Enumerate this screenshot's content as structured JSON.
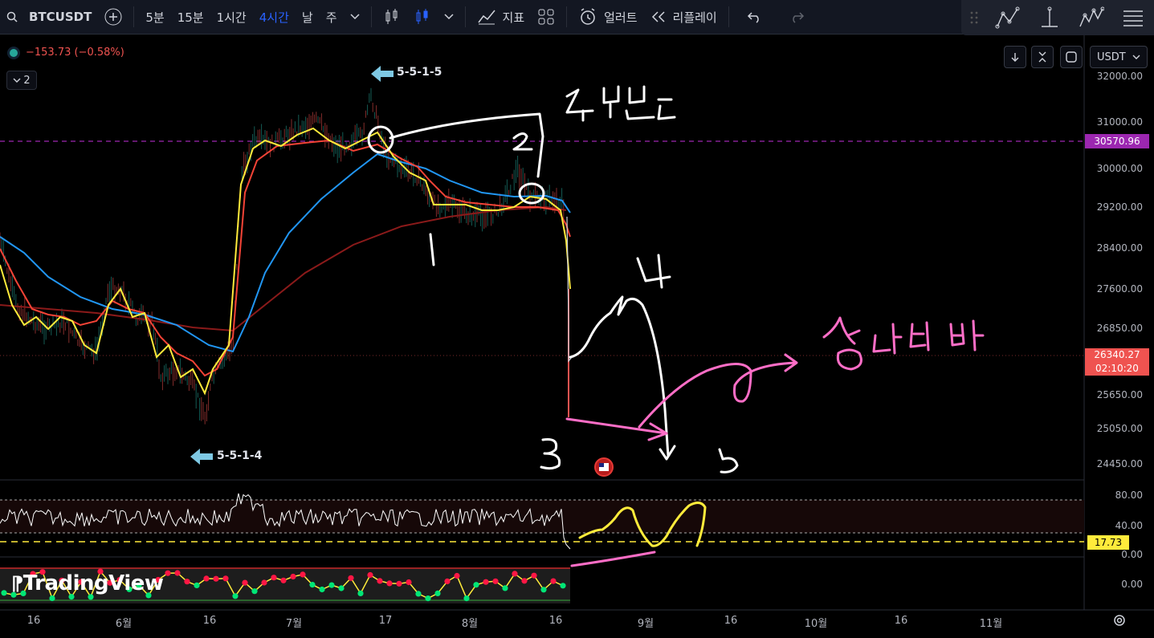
{
  "toolbar": {
    "symbol": "BTCUSDT",
    "intervals": [
      "5분",
      "15분",
      "1시간",
      "4시간",
      "날",
      "주"
    ],
    "active_interval": "4시간",
    "indicators_label": "지표",
    "alert_label": "얼러트",
    "replay_label": "리플레이"
  },
  "legend": {
    "change": "−153.73 (−0.58%)",
    "collapsed_count": "2"
  },
  "currency": "USDT",
  "price_scale": {
    "labels": [
      "32000.00",
      "31000.00",
      "30000.00",
      "29200.00",
      "28400.00",
      "27600.00",
      "26850.00",
      "25650.00",
      "25050.00",
      "24450.00"
    ],
    "highlight_price": "30570.96",
    "current_price": "26340.27",
    "countdown": "02:10:20"
  },
  "rsi_scale": {
    "labels": [
      "80.00",
      "40.00",
      "0.00"
    ],
    "current": "17.73"
  },
  "osc_scale": {
    "labels": [
      "0.00"
    ]
  },
  "time_axis": [
    "16",
    "6월",
    "16",
    "7월",
    "17",
    "8월",
    "16",
    "9월",
    "16",
    "10월",
    "16",
    "11월"
  ],
  "annotations": {
    "wave_top": "5-5-1-5",
    "wave_bottom": "5-5-1-4"
  },
  "logo": "TradingView",
  "colors": {
    "accent": "#2962ff",
    "up": "#26a69a",
    "down": "#ef5350",
    "magenta_line": "#9c27b0",
    "yellow_ma": "#ffeb3b",
    "red_ma": "#f44336",
    "blue_ma": "#2196f3",
    "dark_red_ma": "#8b1a1a"
  },
  "icons": [
    "plus-icon",
    "candles-icon",
    "indicators-icon",
    "layout-icon",
    "alarm-icon",
    "replay-icon",
    "undo-icon",
    "redo-icon",
    "settings-icon"
  ]
}
